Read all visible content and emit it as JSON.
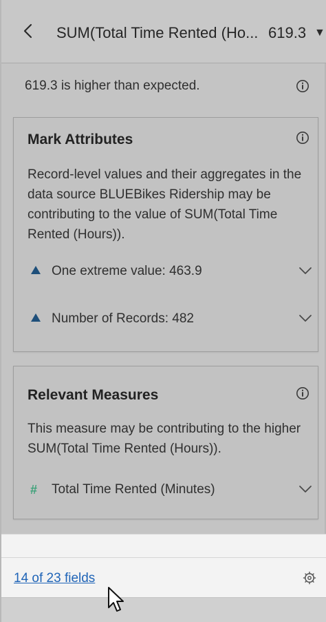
{
  "header": {
    "title": "SUM(Total Time Rented (Ho...",
    "value": "619.3",
    "dropdown_glyph": "▼",
    "back_icon": "chevron-left-icon"
  },
  "summary": {
    "text": "619.3 is higher than expected.",
    "info_icon": "info-icon"
  },
  "mark_attributes": {
    "title": "Mark Attributes",
    "description": "Record-level values and their aggregates in the data source BLUEBikes Ridership may be contributing to the value of SUM(Total Time Rented (Hours)).",
    "items": [
      {
        "label": "One extreme value: 463.9",
        "icon": "triangle-up-icon"
      },
      {
        "label": "Number of Records: 482",
        "icon": "triangle-up-icon"
      }
    ]
  },
  "relevant_measures": {
    "title": "Relevant Measures",
    "description": "This measure may be contributing to the higher SUM(Total Time Rented (Hours)).",
    "items": [
      {
        "label": "Total Time Rented (Minutes)",
        "icon": "hash-icon",
        "glyph": "#"
      }
    ]
  },
  "footer": {
    "fields_link": "14 of 23 fields",
    "settings_icon": "gear-icon"
  },
  "colors": {
    "link": "#1f64b7",
    "triangle": "#1e4f7a",
    "measure_icon": "#3fa27a"
  }
}
